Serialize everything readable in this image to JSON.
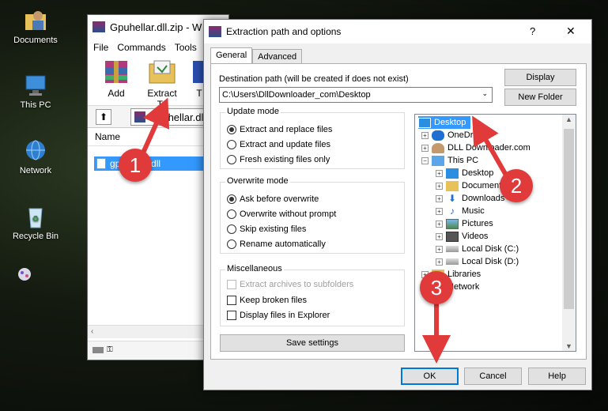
{
  "desktop": {
    "icons": [
      {
        "label": "Documents"
      },
      {
        "label": "This PC"
      },
      {
        "label": "Network"
      },
      {
        "label": "Recycle Bin"
      }
    ]
  },
  "winrar": {
    "title": "Gpuhellar.dll.zip - W",
    "menu": [
      "File",
      "Commands",
      "Tools"
    ],
    "toolbar": {
      "add": "Add",
      "extract_to": "Extract To",
      "third_partial": "T"
    },
    "path": "Gpuhellar.dl",
    "column_name": "Name",
    "file": "gpuhellar.dll"
  },
  "dialog": {
    "title": "Extraction path and options",
    "help_glyph": "?",
    "close_glyph": "✕",
    "tabs": [
      "General",
      "Advanced"
    ],
    "dest_label": "Destination path (will be created if does not exist)",
    "dest_value": "C:\\Users\\DllDownloader_com\\Desktop",
    "display_btn": "Display",
    "new_folder_btn": "New Folder",
    "update_mode": {
      "label": "Update mode",
      "options": [
        "Extract and replace files",
        "Extract and update files",
        "Fresh existing files only"
      ],
      "selected": 0
    },
    "overwrite_mode": {
      "label": "Overwrite mode",
      "options": [
        "Ask before overwrite",
        "Overwrite without prompt",
        "Skip existing files",
        "Rename automatically"
      ],
      "selected": 0
    },
    "misc": {
      "label": "Miscellaneous",
      "options": [
        "Extract archives to subfolders",
        "Keep broken files",
        "Display files in Explorer"
      ]
    },
    "save_settings": "Save settings",
    "tree": [
      {
        "label": "Desktop",
        "icon": "desktop-icon"
      },
      {
        "label": "OneDrive",
        "icon": "cloud-icon"
      },
      {
        "label": "DLL Downloader.com",
        "icon": "user-icon"
      },
      {
        "label": "This PC",
        "icon": "computer-icon"
      },
      {
        "label": "Desktop",
        "icon": "desktop-icon"
      },
      {
        "label": "Documents",
        "icon": "folder-icon"
      },
      {
        "label": "Downloads",
        "icon": "download-icon"
      },
      {
        "label": "Music",
        "icon": "music-icon"
      },
      {
        "label": "Pictures",
        "icon": "pictures-icon"
      },
      {
        "label": "Videos",
        "icon": "videos-icon"
      },
      {
        "label": "Local Disk (C:)",
        "icon": "disk-icon"
      },
      {
        "label": "Local Disk (D:)",
        "icon": "disk-icon"
      },
      {
        "label": "Libraries",
        "icon": "folder-icon"
      },
      {
        "label": "Network",
        "icon": "network-icon"
      }
    ],
    "ok": "OK",
    "cancel": "Cancel",
    "help": "Help"
  },
  "annotations": {
    "step1": "1",
    "step2": "2",
    "step3": "3",
    "color": "#e03a3a"
  }
}
